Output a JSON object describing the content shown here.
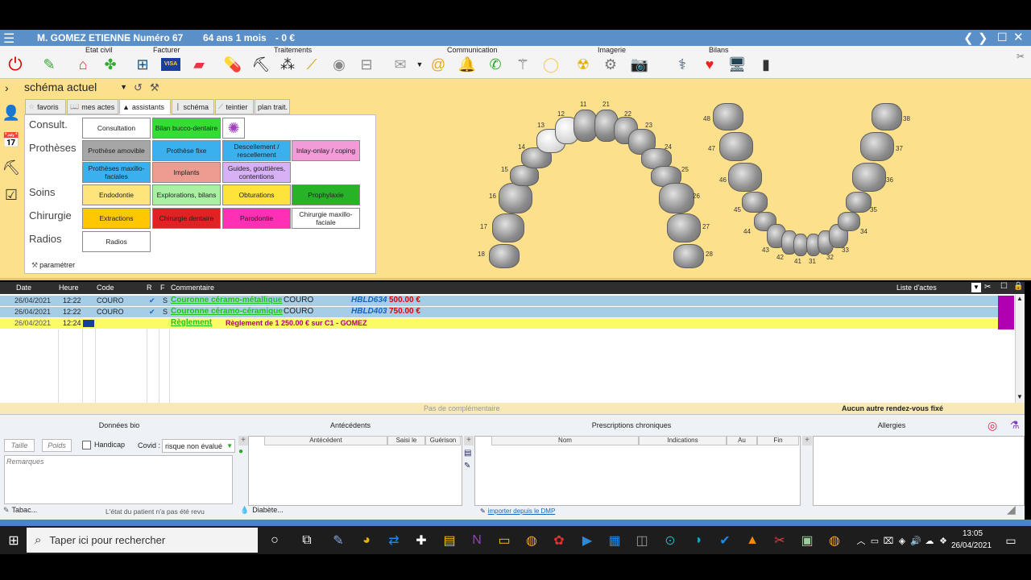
{
  "title_bar": {
    "patient_name": "M. GOMEZ ETIENNE",
    "file_number": "- Numéro 67",
    "age": "64 ans 1 mois",
    "balance": "- 0 €"
  },
  "toolbar": {
    "groups": [
      "Etat civil",
      "Facturer",
      "Traitements",
      "Communication",
      "Imagerie",
      "Bilans"
    ]
  },
  "schema": {
    "selected": "schéma actuel",
    "tabs": [
      "favoris",
      "mes actes",
      "assistants",
      "schéma",
      "teintier",
      "plan trait."
    ],
    "active_tab": "assistants"
  },
  "assistants": {
    "row_labels": [
      "Consult.",
      "Prothèses",
      "Soins",
      "Chirurgie",
      "Radios"
    ],
    "items": [
      {
        "label": "Consultation",
        "color": "#ffffff"
      },
      {
        "label": "Bilan bucco-dentaire",
        "color": "#33dd33"
      },
      {
        "label": "Prothèse amovible",
        "color": "#a6a6a6"
      },
      {
        "label": "Prothèse fixe",
        "color": "#3bb0ef"
      },
      {
        "label": "Descellement / rescellement",
        "color": "#3bb0ef"
      },
      {
        "label": "Inlay-onlay / coping",
        "color": "#f39ad9"
      },
      {
        "label": "Prothèses maxillo-faciales",
        "color": "#3bb0ef"
      },
      {
        "label": "Implants",
        "color": "#ee9b92"
      },
      {
        "label": "Guides, gouttières, contentions",
        "color": "#d7b0f5"
      },
      {
        "label": "Endodontie",
        "color": "#fde47b"
      },
      {
        "label": "Explorations, bilans",
        "color": "#a9f0a3"
      },
      {
        "label": "Obturations",
        "color": "#fde33a"
      },
      {
        "label": "Prophylaxie",
        "color": "#27b328"
      },
      {
        "label": "Extractions",
        "color": "#ffc700"
      },
      {
        "label": "Chirurgie dentaire",
        "color": "#e02222"
      },
      {
        "label": "Parodontie",
        "color": "#ff2fb6"
      },
      {
        "label": "Chirurgie maxillo-faciale",
        "color": "#ffffff"
      },
      {
        "label": "Radios",
        "color": "#ffffff"
      }
    ],
    "settings_label": "paramétrer"
  },
  "teeth_numbers": {
    "upper": [
      "11",
      "12",
      "13",
      "14",
      "15",
      "16",
      "17",
      "18",
      "21",
      "22",
      "23",
      "24",
      "25",
      "26",
      "27",
      "28"
    ],
    "lower": [
      "48",
      "47",
      "46",
      "45",
      "44",
      "43",
      "42",
      "41",
      "31",
      "32",
      "33",
      "34",
      "35",
      "36",
      "37",
      "38"
    ]
  },
  "acts_table": {
    "headers": [
      "Date",
      "Heure",
      "Code",
      "R",
      "F",
      "Commentaire"
    ],
    "list_label": "Liste d'actes",
    "rows": [
      {
        "date": "26/04/2021",
        "time": "12:22",
        "code": "COURO",
        "check": "✔",
        "flag": "S",
        "act": "Couronne céramo-métallique",
        "code2": "COURO",
        "hbl": "HBLD634",
        "amount": "500.00 €"
      },
      {
        "date": "26/04/2021",
        "time": "12:22",
        "code": "COURO",
        "check": "✔",
        "flag": "S",
        "act": "Couronne céramo-céramique",
        "code2": "COURO",
        "hbl": "HBLD403",
        "amount": "750.00 €"
      },
      {
        "date": "26/04/2021",
        "time": "12:24",
        "act": "Règlement",
        "comment": "Règlement de 1 250.00 € sur C1 - GOMEZ"
      }
    ]
  },
  "status_line": {
    "complementary": "Pas de complémentaire",
    "appointment": "Aucun autre rendez-vous fixé"
  },
  "bottom": {
    "panels": [
      "Données bio",
      "Antécédents",
      "Prescriptions chroniques",
      "Allergies"
    ],
    "bio": {
      "height_placeholder": "Taille",
      "weight_placeholder": "Poids",
      "handicap_label": "Handicap",
      "covid_label": "Covid :",
      "covid_value": "risque non évalué",
      "remarks_placeholder": "Remarques",
      "tobacco": "Tabac...",
      "state_note": "L'état du patient n'a pas été revu"
    },
    "antecedents": {
      "columns": [
        "Antécédent",
        "Saisi le",
        "Guérison"
      ],
      "diabetes": "Diabète..."
    },
    "prescriptions": {
      "columns": [
        "Nom",
        "Indications",
        "Au",
        "Fin"
      ],
      "import_link": "importer depuis le DMP"
    }
  },
  "taskbar": {
    "search_placeholder": "Taper ici pour rechercher",
    "time": "13:05",
    "date": "26/04/2021"
  },
  "colors": {
    "title_bar": "#5b8fc7",
    "panel_bg": "#fde08c",
    "row_highlight": "#a5cde8",
    "payment_row": "#fbfb66",
    "act_link": "#1fc11f",
    "amount": "#e00000"
  }
}
